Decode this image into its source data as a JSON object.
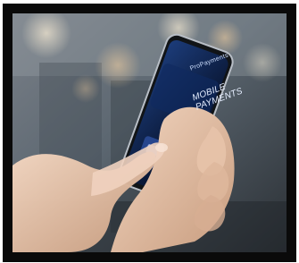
{
  "screen": {
    "brand": "ProPayments",
    "headline_line1": "MOBILE",
    "headline_line2": "PAYMENTS"
  },
  "colors": {
    "frame": "#0a0a0a",
    "phone_screen": "#0b1a3a",
    "skin": "#e8c4a8",
    "background_blur": "#4a5a66"
  },
  "icons": {
    "card": "credit-card-icon"
  }
}
